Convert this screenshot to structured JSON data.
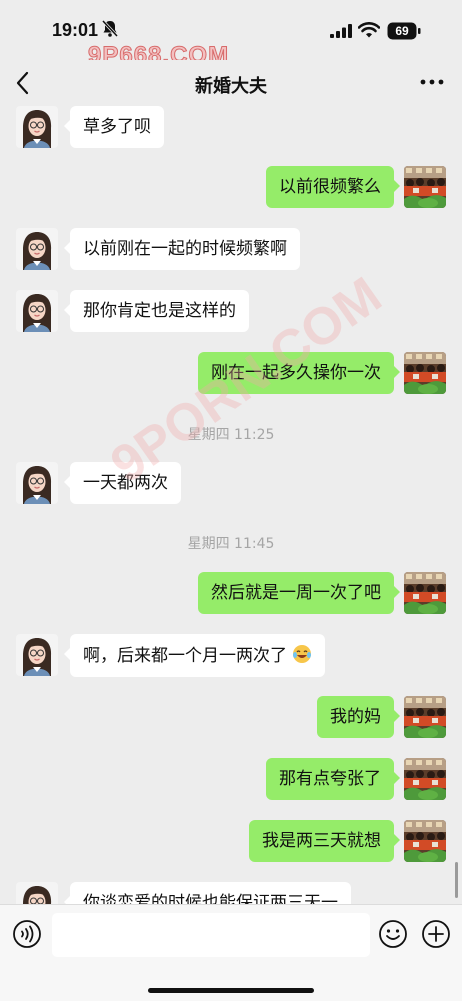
{
  "status_bar": {
    "time": "19:01",
    "battery": "69"
  },
  "watermark": {
    "top": "9P668.COM",
    "middle": "9PORN.COM"
  },
  "header": {
    "title": "新婚大夫"
  },
  "messages": [
    {
      "side": "left",
      "text": "草多了呗"
    },
    {
      "side": "right",
      "text": "以前很频繁么"
    },
    {
      "side": "left",
      "text": "以前刚在一起的时候频繁啊"
    },
    {
      "side": "left",
      "text": "那你肯定也是这样的"
    },
    {
      "side": "right",
      "text": "刚在一起多久操你一次"
    },
    {
      "timestamp": "星期四 11:25"
    },
    {
      "side": "left",
      "text": "一天都两次"
    },
    {
      "timestamp": "星期四 11:45"
    },
    {
      "side": "right",
      "text": "然后就是一周一次了吧"
    },
    {
      "side": "left",
      "text": "啊，后来都一个月一两次了",
      "emoji": "laughing-tears-emoji"
    },
    {
      "side": "right",
      "text": "我的妈"
    },
    {
      "side": "right",
      "text": "那有点夸张了"
    },
    {
      "side": "right",
      "text": "我是两三天就想"
    },
    {
      "side": "left",
      "text": "你谈恋爱的时候也能保证两三天一"
    }
  ],
  "colors": {
    "background": "#ededed",
    "sent_bubble": "#95ec69",
    "received_bubble": "#ffffff",
    "timestamp": "#a5a5a5"
  },
  "icons": [
    "bell-slash-icon",
    "signal-icon",
    "wifi-icon",
    "battery-icon",
    "back-chevron-icon",
    "more-dots-icon",
    "voice-icon",
    "emoji-icon",
    "plus-icon"
  ]
}
